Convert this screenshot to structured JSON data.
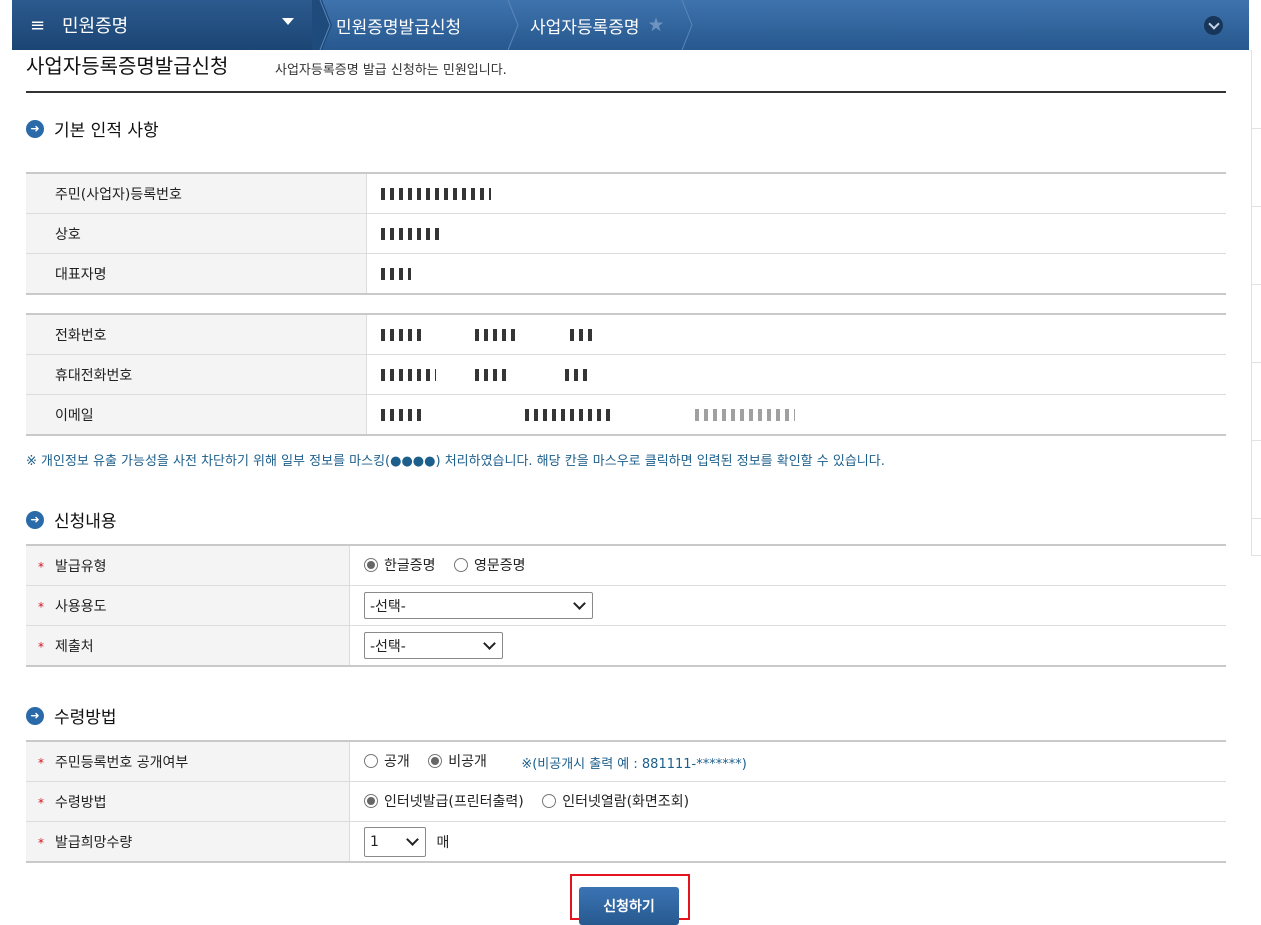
{
  "nav": {
    "menu_glyph": "≡",
    "main": "민원증명",
    "crumb1": "민원증명발급신청",
    "crumb2": "사업자등록증명",
    "star_glyph": "★"
  },
  "page": {
    "title": "사업자등록증명발급신청",
    "description": "사업자등록증명 발급 신청하는 민원입니다."
  },
  "basic": {
    "heading": "기본 인적 사항",
    "rows_a": [
      {
        "label": "주민(사업자)등록번호"
      },
      {
        "label": "상호"
      },
      {
        "label": "대표자명"
      }
    ],
    "rows_b": [
      {
        "label": "전화번호"
      },
      {
        "label": "휴대전화번호"
      },
      {
        "label": "이메일"
      }
    ],
    "notice": "※ 개인정보 유출 가능성을 사전 차단하기 위해 일부 정보를 마스킹(●●●●) 처리하였습니다. 해당 칸을 마스우로 클릭하면 입력된 정보를 확인할 수 있습니다."
  },
  "request": {
    "heading": "신청내용",
    "issue_type_label": "발급유형",
    "issue_type_options": [
      "한글증명",
      "영문증명"
    ],
    "usage_label": "사용용도",
    "usage_value": "-선택-",
    "submit_to_label": "제출처",
    "submit_to_value": "-선택-"
  },
  "receive": {
    "heading": "수령방법",
    "disclosure_label": "주민등록번호 공개여부",
    "disclosure_options": [
      "공개",
      "비공개"
    ],
    "disclosure_hint": "※(비공개시 출력 예 : 881111-*******)",
    "method_label": "수령방법",
    "method_options": [
      "인터넷발급(프린터출력)",
      "인터넷열람(화면조회)"
    ],
    "quantity_label": "발급희망수량",
    "quantity_value": "1",
    "quantity_unit": "매"
  },
  "submit_label": "신청하기",
  "colors": {
    "accent": "#2a6aa8",
    "highlight_border": "#e2141e",
    "notice": "#1c5f8c"
  }
}
